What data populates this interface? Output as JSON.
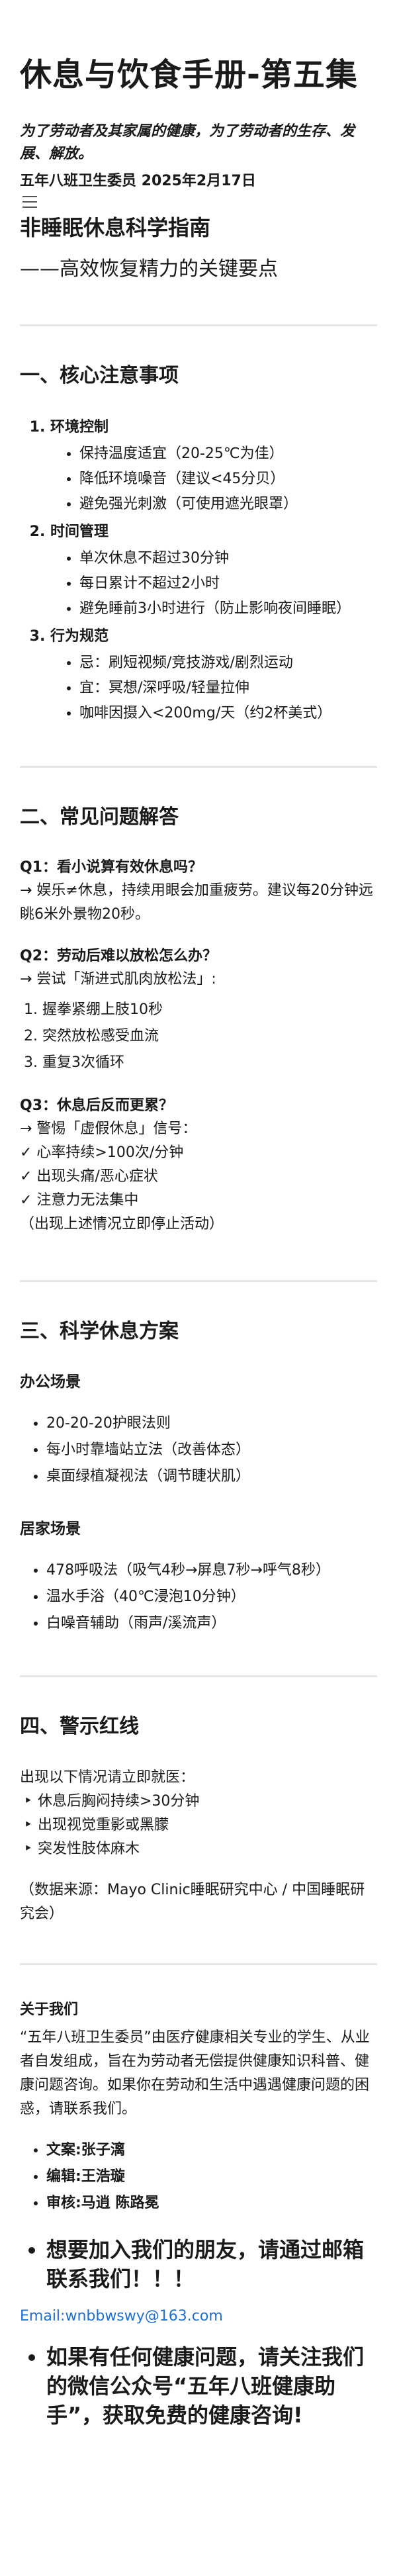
{
  "doc": {
    "title": "休息与饮食手册-第五集",
    "intro": "为了劳动者及其家属的健康，为了劳动者的生存、发展、解放。",
    "meta": "五年八班卫生委员 2025年2月17日",
    "heading": "非睡眠休息科学指南",
    "subheading": "——高效恢复精力的关键要点"
  },
  "s1": {
    "title": "一、核心注意事项",
    "groups": [
      {
        "label": "环境控制",
        "items": [
          "保持温度适宜（20-25℃为佳）",
          "降低环境噪音（建议<45分贝）",
          "避免强光刺激（可使用遮光眼罩）"
        ]
      },
      {
        "label": "时间管理",
        "items": [
          "单次休息不超过30分钟",
          "每日累计不超过2小时",
          "避免睡前3小时进行（防止影响夜间睡眠）"
        ]
      },
      {
        "label": "行为规范",
        "items": [
          "忌：刷短视频/竞技游戏/剧烈运动",
          "宜：冥想/深呼吸/轻量拉伸",
          "咖啡因摄入<200mg/天（约2杯美式）"
        ]
      }
    ]
  },
  "s2": {
    "title": "二、常见问题解答",
    "q1": "Q1：看小说算有效休息吗？",
    "a1": "→ 娱乐≠休息，持续用眼会加重疲劳。建议每20分钟远眺6米外景物20秒。",
    "q2": "Q2：劳动后难以放松怎么办？",
    "a2": "→ 尝试「渐进式肌肉放松法」:",
    "steps": [
      "握拳紧绷上肢10秒",
      "突然放松感受血流",
      "重复3次循环"
    ],
    "q3": "Q3：休息后反而更累？",
    "a3": "→ 警惕「虚假休息」信号：",
    "checks": [
      "✓ 心率持续>100次/分钟",
      "✓ 出现头痛/恶心症状",
      "✓ 注意力无法集中"
    ],
    "note": "（出现上述情况立即停止活动）"
  },
  "s3": {
    "title": "三、科学休息方案",
    "office_label": "办公场景",
    "office": [
      "20-20-20护眼法则",
      "每小时靠墙站立法（改善体态）",
      "桌面绿植凝视法（调节睫状肌）"
    ],
    "home_label": "居家场景",
    "home": [
      "478呼吸法（吸气4秒→屏息7秒→呼气8秒）",
      "温水手浴（40℃浸泡10分钟）",
      "白噪音辅助（雨声/溪流声）"
    ]
  },
  "s4": {
    "title": "四、警示红线",
    "lead": "出现以下情况请立即就医：",
    "items": [
      "休息后胸闷持续>30分钟",
      "出现视觉重影或黑朦",
      "突发性肢体麻木"
    ],
    "source": "（数据来源：Mayo Clinic睡眠研究中心 / 中国睡眠研究会）"
  },
  "about": {
    "heading": "关于我们",
    "text": "“五年八班卫生委员”由医疗健康相关专业的学生、从业者自发组成，旨在为劳动者无偿提供健康知识科普、健康问题咨询。如果你在劳动和生活中遇遇健康问题的困惑，请联系我们。",
    "credits": [
      "文案:张子漓",
      "编辑:王浩璇",
      "审核:马逍 陈路冕"
    ],
    "cta": "想要加入我们的朋友，请通过邮箱联系我们！！！",
    "email": "Email:wnbbwswy@163.com",
    "cta2": "如果有任何健康问题，请关注我们的微信公众号“五年八班健康助手”，获取免费的健康咨询!"
  }
}
